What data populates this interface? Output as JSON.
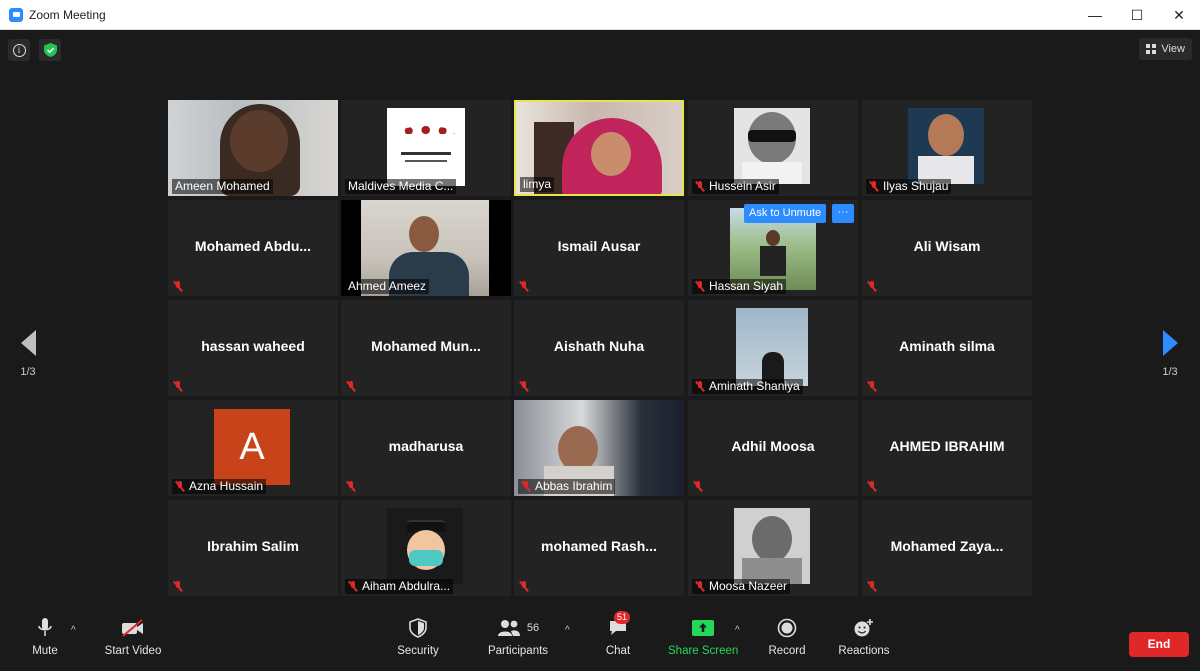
{
  "window": {
    "title": "Zoom Meeting",
    "minimize": "—",
    "maximize": "☐",
    "close": "✕"
  },
  "view_label": "View",
  "page_indicator_left": "1/3",
  "page_indicator_right": "1/3",
  "ask_unmute": "Ask to Unmute",
  "more": "···",
  "participants": [
    {
      "name": "Ameen Mohamed",
      "video": true,
      "muted": false,
      "photo": "headset-man"
    },
    {
      "name": "Maldives Media C...",
      "video": true,
      "muted": false,
      "photo": "logo"
    },
    {
      "name": "limya",
      "video": true,
      "muted": false,
      "photo": "hijab-woman",
      "active": true
    },
    {
      "name": "Hussein Asir",
      "video": true,
      "muted": true,
      "photo": "sunglasses-bw"
    },
    {
      "name": "Ilyas Shujau",
      "video": true,
      "muted": true,
      "photo": "man-white-shirt"
    },
    {
      "name": "Mohamed  Abdu...",
      "video": false,
      "muted": true
    },
    {
      "name": "Ahmed Ameez",
      "video": true,
      "muted": false,
      "photo": "man-room"
    },
    {
      "name": "Ismail Ausar",
      "video": false,
      "muted": true
    },
    {
      "name": "Hassan Siyah",
      "video": true,
      "muted": true,
      "photo": "man-field"
    },
    {
      "name": "Ali Wisam",
      "video": false,
      "muted": true
    },
    {
      "name": "hassan waheed",
      "video": false,
      "muted": true
    },
    {
      "name": "Mohamed  Mun...",
      "video": false,
      "muted": true
    },
    {
      "name": "Aishath Nuha",
      "video": false,
      "muted": true
    },
    {
      "name": "Aminath Shaniya",
      "video": true,
      "muted": true,
      "photo": "silhouette-sky"
    },
    {
      "name": "Aminath silma",
      "video": false,
      "muted": true
    },
    {
      "name": "Azna Hussain",
      "video": true,
      "muted": true,
      "photo": "avatar-a",
      "initial": "A"
    },
    {
      "name": "madharusa",
      "video": false,
      "muted": true
    },
    {
      "name": "Abbas Ibrahim",
      "video": true,
      "muted": true,
      "photo": "older-man"
    },
    {
      "name": "Adhil Moosa",
      "video": false,
      "muted": true
    },
    {
      "name": "AHMED IBRAHIM",
      "video": false,
      "muted": true
    },
    {
      "name": "Ibrahim Salim",
      "video": false,
      "muted": true
    },
    {
      "name": "Aiham Abdulra...",
      "video": true,
      "muted": true,
      "photo": "cartoon-mask"
    },
    {
      "name": "mohamed  Rash...",
      "video": false,
      "muted": true
    },
    {
      "name": "Moosa Nazeer",
      "video": true,
      "muted": true,
      "photo": "smiling-bw"
    },
    {
      "name": "Mohamed  Zaya...",
      "video": false,
      "muted": true
    }
  ],
  "toolbar": {
    "mute": "Mute",
    "start_video": "Start Video",
    "security": "Security",
    "participants": "Participants",
    "participants_count": "56",
    "chat": "Chat",
    "chat_badge": "51",
    "share_screen": "Share Screen",
    "record": "Record",
    "reactions": "Reactions",
    "end": "End"
  },
  "colors": {
    "accent": "#2d8cff",
    "end": "#e02828",
    "share": "#23d959",
    "active_speaker": "#e6e64a"
  }
}
